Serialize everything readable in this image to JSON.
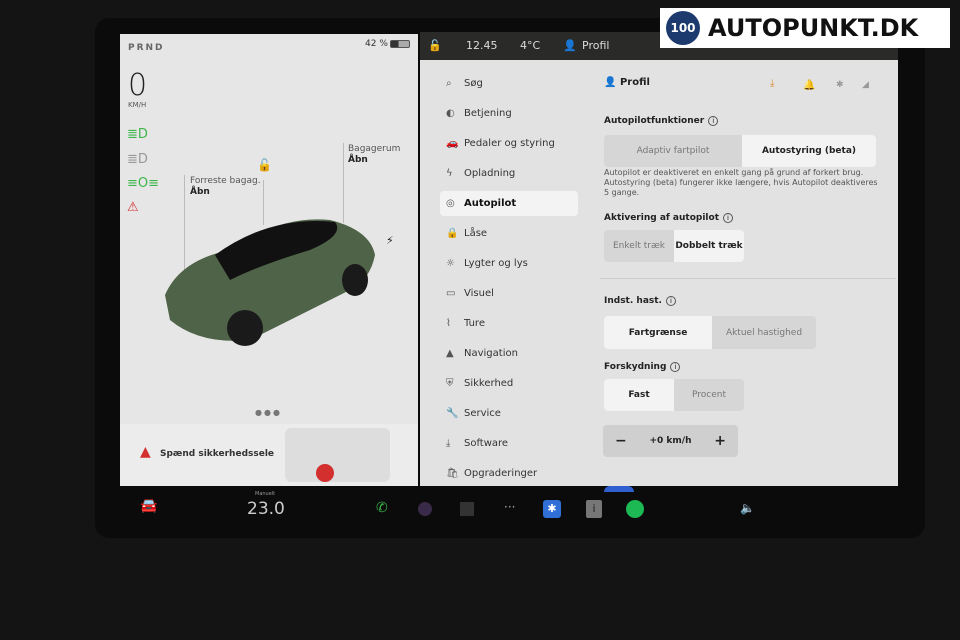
{
  "logo": {
    "badge": "100",
    "text": "AUTOPUNKT.DK"
  },
  "status": {
    "time": "12.45",
    "temp": "4°C",
    "profile": "Profil"
  },
  "left": {
    "gear": "PRND",
    "battery": "42 %",
    "battery_level": 42,
    "speed": "0",
    "speed_unit": "KM/H",
    "front_trunk": {
      "label": "Forreste bagag.",
      "action": "Åbn"
    },
    "trunk": {
      "label": "Bagagerum",
      "action": "Åbn"
    },
    "alert": "Spænd sikkerhedssele"
  },
  "sidebar": {
    "search": "Søg",
    "items": [
      {
        "label": "Betjening",
        "icon": "toggle"
      },
      {
        "label": "Pedaler og styring",
        "icon": "car"
      },
      {
        "label": "Opladning",
        "icon": "bolt"
      },
      {
        "label": "Autopilot",
        "icon": "steering-wheel",
        "active": true
      },
      {
        "label": "Låse",
        "icon": "lock"
      },
      {
        "label": "Lygter og lys",
        "icon": "sun"
      },
      {
        "label": "Visuel",
        "icon": "display"
      },
      {
        "label": "Ture",
        "icon": "trips"
      },
      {
        "label": "Navigation",
        "icon": "navigation"
      },
      {
        "label": "Sikkerhed",
        "icon": "shield"
      },
      {
        "label": "Service",
        "icon": "wrench"
      },
      {
        "label": "Software",
        "icon": "download"
      },
      {
        "label": "Opgraderinger",
        "icon": "bag"
      }
    ]
  },
  "content": {
    "profile": "Profil",
    "autopilot_features": {
      "title": "Autopilotfunktioner",
      "options": [
        "Adaptiv fartpilot",
        "Autostyring (beta)"
      ],
      "selected": 1
    },
    "description": "Autopilot er deaktiveret en enkelt gang på grund af forkert brug. Autostyring (beta) fungerer ikke længere, hvis Autopilot deaktiveres 5 gange.",
    "activation": {
      "title": "Aktivering af autopilot",
      "options": [
        "Enkelt træk",
        "Dobbelt træk"
      ],
      "selected": 1
    },
    "set_speed": {
      "title": "Indst. hast.",
      "options": [
        "Fartgrænse",
        "Aktuel hastighed"
      ],
      "selected": 0
    },
    "offset": {
      "title": "Forskydning",
      "options": [
        "Fast",
        "Procent"
      ],
      "selected": 0
    },
    "offset_value": "+0 km/h",
    "minus": "−",
    "plus": "+"
  },
  "dock": {
    "climate_label": "Manuelt",
    "temperature": "23.0"
  },
  "colors": {
    "accent_green": "#3cb54a",
    "alert_red": "#d32f2f",
    "bluetooth": "#2f6fd6",
    "spotify": "#1db954"
  }
}
